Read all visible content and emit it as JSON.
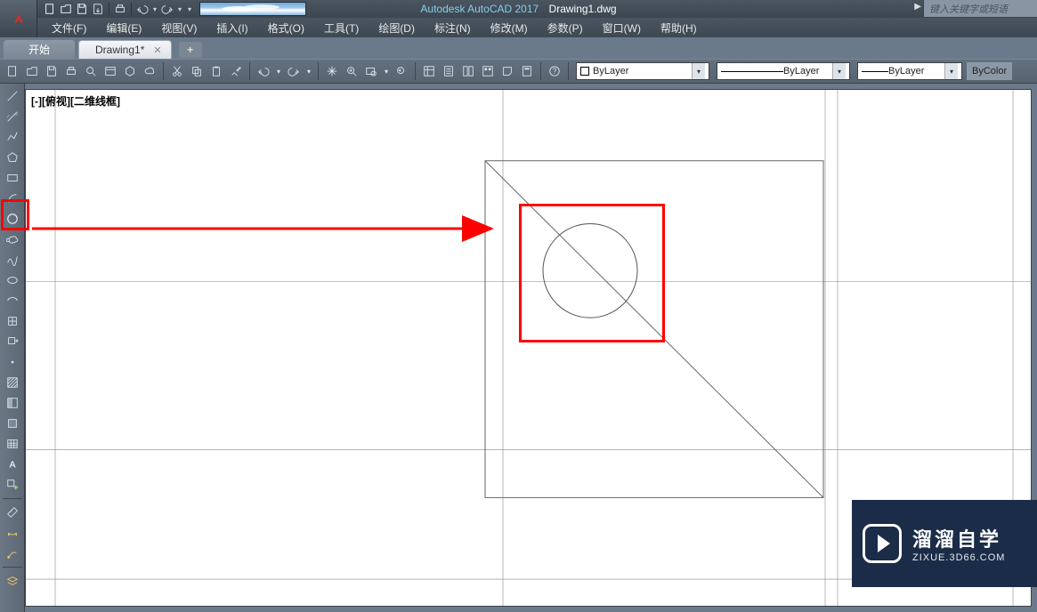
{
  "app_title": "Autodesk AutoCAD 2017",
  "doc_name": "Drawing1.dwg",
  "search_placeholder": "键入关键字或短语",
  "menu": [
    "文件(F)",
    "编辑(E)",
    "视图(V)",
    "插入(I)",
    "格式(O)",
    "工具(T)",
    "绘图(D)",
    "标注(N)",
    "修改(M)",
    "参数(P)",
    "窗口(W)",
    "帮助(H)"
  ],
  "tabs": {
    "home": "开始",
    "active": "Drawing1*",
    "add": "+"
  },
  "toolbar_h_groups": [
    [
      "new",
      "open",
      "save",
      "saveas",
      "plot"
    ],
    [
      "cut",
      "copy",
      "paste",
      "matchprop"
    ],
    [
      "undo",
      "redo"
    ],
    [
      "pan",
      "zoom-realtime",
      "zoom-window",
      "zoom-prev"
    ],
    [
      "props",
      "sheet",
      "toolpalettes",
      "designcenter",
      "markup",
      "quickcalc"
    ],
    [
      "help"
    ]
  ],
  "layer_combos": {
    "layer": "ByLayer",
    "linetype": "ByLayer",
    "lineweight": "ByLayer",
    "bycolor": "ByColor"
  },
  "toolbar_v": [
    "line",
    "construction-line",
    "polyline",
    "polygon",
    "rectangle",
    "arc",
    "circle",
    "revision-cloud",
    "spline",
    "ellipse",
    "ellipse-arc",
    "insert-block",
    "make-block",
    "point",
    "hatch",
    "gradient",
    "region",
    "table",
    "text",
    "add-selected",
    "SEP",
    "measure",
    "dim-linear",
    "leader",
    "SEP",
    "layer-iso"
  ],
  "viewport_label": "[-][俯视][二维线框]",
  "watermark": {
    "cn": "溜溜自学",
    "url": "ZIXUE.3D66.COM"
  }
}
